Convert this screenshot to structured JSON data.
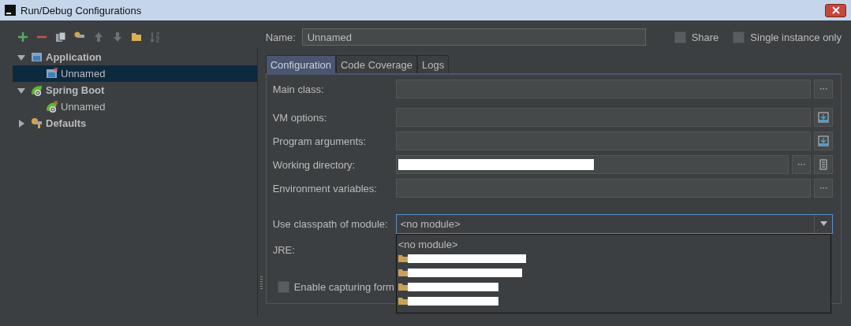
{
  "window": {
    "title": "Run/Debug Configurations"
  },
  "toolbar": [
    {
      "kind": "add"
    },
    {
      "kind": "remove"
    },
    {
      "kind": "copy"
    },
    {
      "kind": "wrench"
    },
    {
      "kind": "up"
    },
    {
      "kind": "down"
    },
    {
      "kind": "folder"
    },
    {
      "kind": "sort"
    }
  ],
  "tree": [
    {
      "label": "Application",
      "kind": "application",
      "expanded": true,
      "selected": false,
      "children": [
        {
          "label": "Unnamed",
          "kind": "application-error",
          "selected": true
        }
      ]
    },
    {
      "label": "Spring Boot",
      "kind": "spring",
      "expanded": true,
      "selected": false,
      "children": [
        {
          "label": "Unnamed",
          "kind": "spring-error",
          "selected": false
        }
      ]
    },
    {
      "label": "Defaults",
      "kind": "wrench",
      "expanded": false,
      "selected": false
    }
  ],
  "name": {
    "label": "Name:",
    "value": "Unnamed"
  },
  "options": [
    {
      "label": "Share",
      "checked": false
    },
    {
      "label": "Single instance only",
      "checked": false
    }
  ],
  "tabs": [
    {
      "label": "Configuration",
      "selected": true
    },
    {
      "label": "Code Coverage",
      "selected": false
    },
    {
      "label": "Logs",
      "selected": false
    }
  ],
  "fields": [
    {
      "label": "Main class:",
      "kind": "browse",
      "redacted": false
    },
    {
      "label": "VM options:",
      "kind": "expand",
      "redacted": false
    },
    {
      "label": "Program arguments:",
      "kind": "expand",
      "redacted": false
    },
    {
      "label": "Working directory:",
      "kind": "directory",
      "redacted": true
    },
    {
      "label": "Environment variables:",
      "kind": "browse",
      "redacted": false
    }
  ],
  "module": {
    "label": "Use classpath of module:",
    "value": "<no module>",
    "expanded": true,
    "options": [
      {
        "kind": "text",
        "label": "<no module>"
      },
      {
        "kind": "redacted"
      },
      {
        "kind": "redacted"
      },
      {
        "kind": "redacted"
      },
      {
        "kind": "redacted"
      }
    ]
  },
  "jre": {
    "label": "JRE:"
  },
  "capture": {
    "label": "Enable capturing form",
    "checked": false
  }
}
